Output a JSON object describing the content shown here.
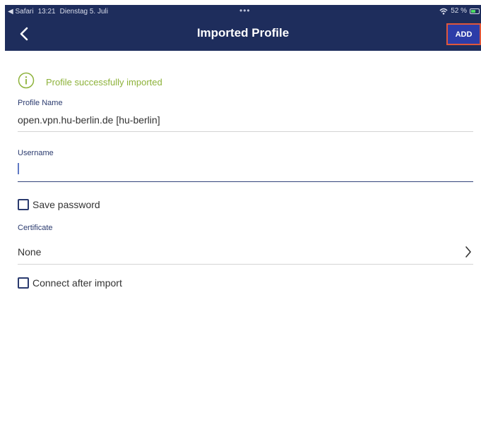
{
  "status_bar": {
    "back_app": "◀ Safari",
    "time": "13:21",
    "date": "Dienstag 5. Juli",
    "dots": "•••",
    "battery": "52 %"
  },
  "nav": {
    "title": "Imported Profile",
    "add_label": "ADD"
  },
  "notice": {
    "text": "Profile successfully imported"
  },
  "form": {
    "profile_name_label": "Profile Name",
    "profile_name_value": "open.vpn.hu-berlin.de [hu-berlin]",
    "username_label": "Username",
    "username_value": "",
    "save_password_label": "Save password",
    "save_password_checked": false,
    "certificate_label": "Certificate",
    "certificate_value": "None",
    "connect_after_import_label": "Connect after import",
    "connect_after_import_checked": false
  },
  "colors": {
    "nav_bg": "#1e2d5c",
    "add_bg": "#2c3ca8",
    "add_border": "#e0573a",
    "success": "#8db23a",
    "label": "#2a3a6e"
  }
}
